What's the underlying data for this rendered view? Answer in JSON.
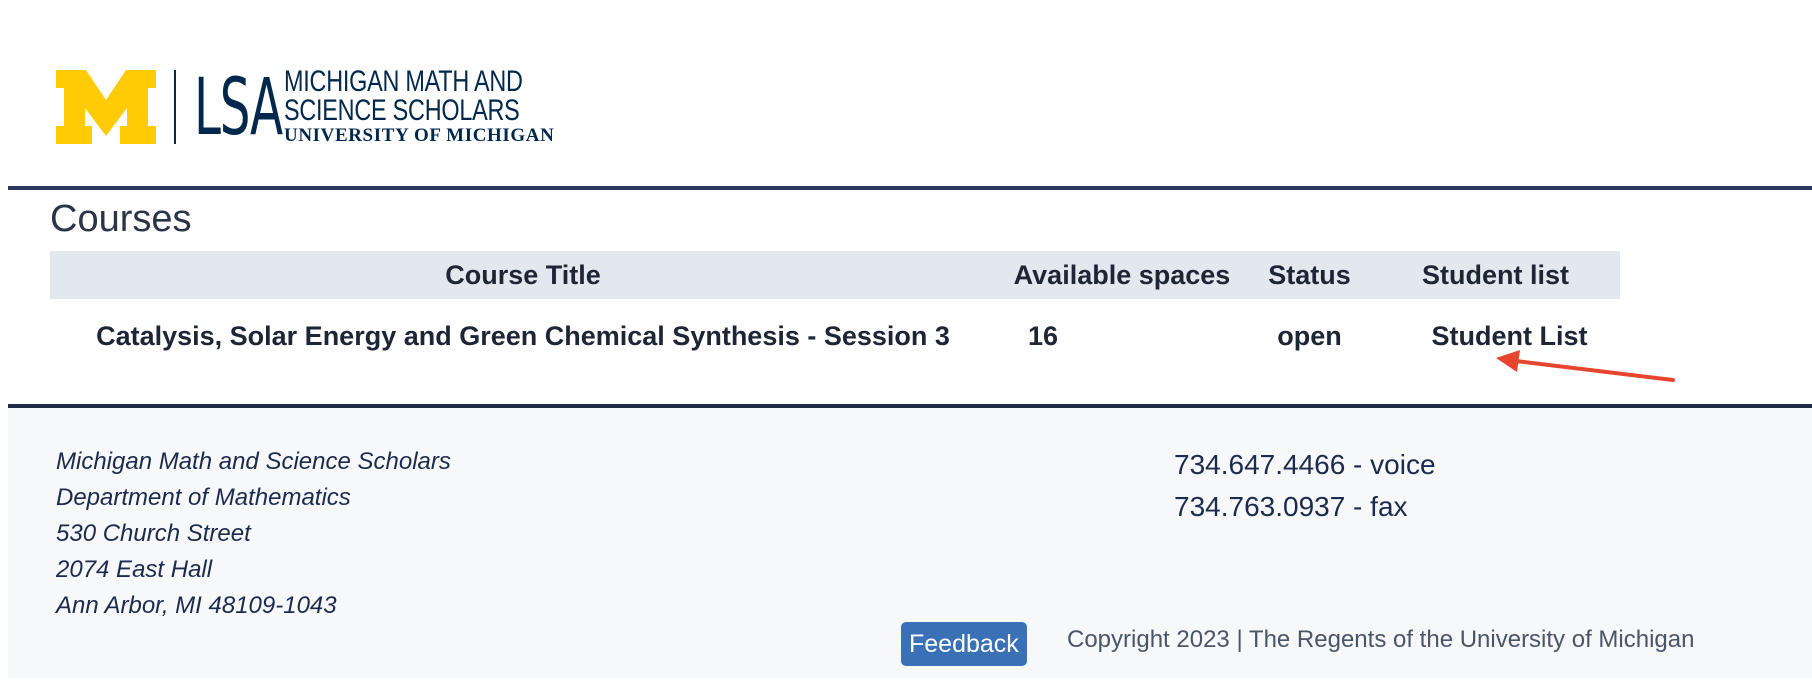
{
  "header": {
    "logo": {
      "name": "university-of-michigan-lsa-logo",
      "line1": "MICHIGAN MATH AND",
      "line2": "SCIENCE SCHOLARS",
      "line3": "UNIVERSITY OF MICHIGAN",
      "wordmark": "LSA",
      "colors": {
        "maize": "#FFCB05",
        "blue": "#00274C"
      }
    }
  },
  "main": {
    "title": "Courses",
    "table": {
      "columns": [
        "Course Title",
        "Available spaces",
        "Status",
        "Student list"
      ],
      "rows": [
        {
          "course_title": "Catalysis, Solar Energy and Green Chemical Synthesis - Session 3",
          "available_spaces": "16",
          "status": "open",
          "student_list": "Student List"
        }
      ]
    },
    "annotation": {
      "type": "arrow",
      "color": "#E8452F",
      "points_to": "student-list-link"
    }
  },
  "footer": {
    "address": [
      "Michigan Math and Science Scholars",
      "Department of Mathematics",
      "530 Church Street",
      "2074 East Hall",
      "Ann Arbor, MI 48109-1043"
    ],
    "contact": [
      "734.647.4466 - voice",
      "734.763.0937 - fax"
    ],
    "feedback_label": "Feedback",
    "copyright": "Copyright 2023 | The Regents of the University of Michigan"
  }
}
